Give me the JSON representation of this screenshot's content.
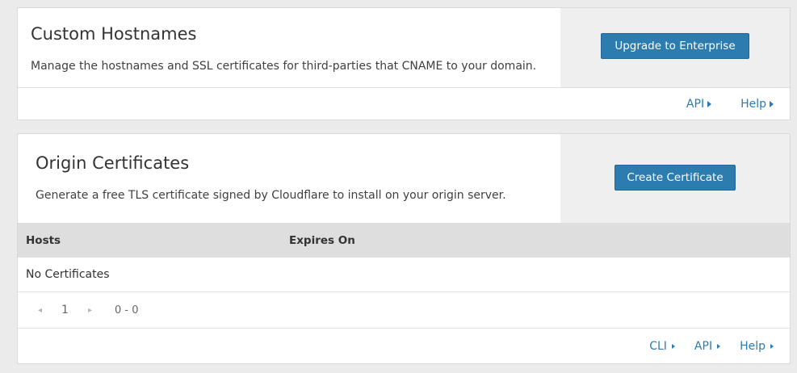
{
  "custom_hostnames": {
    "title": "Custom Hostnames",
    "description": "Manage the hostnames and SSL certificates for third-parties that CNAME to your domain.",
    "button_label": "Upgrade to Enterprise",
    "links": [
      {
        "label": "API"
      },
      {
        "label": "Help"
      }
    ]
  },
  "origin_certificates": {
    "title": "Origin Certificates",
    "description": "Generate a free TLS certificate signed by Cloudflare to install on your origin server.",
    "button_label": "Create Certificate",
    "table": {
      "columns": [
        "Hosts",
        "Expires On"
      ],
      "empty_text": "No Certificates"
    },
    "pagination": {
      "prev_icon": "chevron-left-icon",
      "next_icon": "chevron-right-icon",
      "prev_glyph": "◂",
      "next_glyph": "▸",
      "current_page": "1",
      "range": "0 - 0"
    },
    "links": [
      {
        "label": "CLI"
      },
      {
        "label": "API"
      },
      {
        "label": "Help"
      }
    ]
  },
  "colors": {
    "accent": "#2c7cb0",
    "background": "#ebebeb",
    "aside": "#efefef",
    "table_header": "#dedede"
  }
}
